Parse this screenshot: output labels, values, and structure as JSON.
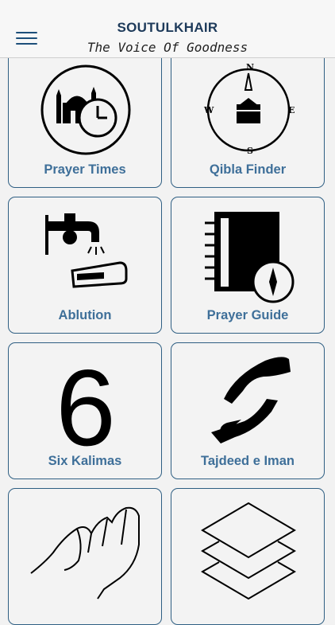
{
  "header": {
    "title": "SOUTULKHAIR",
    "subtitle": "The Voice Of Goodness",
    "menu_icon": "hamburger-menu-icon"
  },
  "tiles": [
    {
      "label": "Prayer Times",
      "icon": "mosque-clock-icon"
    },
    {
      "label": "Qibla Finder",
      "icon": "compass-kaaba-icon"
    },
    {
      "label": "Ablution",
      "icon": "faucet-hands-icon"
    },
    {
      "label": "Prayer Guide",
      "icon": "book-compass-icon"
    },
    {
      "label": "Six Kalimas",
      "icon": "number-six-icon",
      "icon_text": "6"
    },
    {
      "label": "Tajdeed e Iman",
      "icon": "hands-icon"
    },
    {
      "label": "",
      "icon": "praying-hands-icon"
    },
    {
      "label": "",
      "icon": "layers-icon"
    }
  ],
  "compass_letters": {
    "n": "N",
    "e": "E",
    "s": "S",
    "w": "W"
  },
  "colors": {
    "accent": "#1d4f7a",
    "label": "#3e6f99",
    "border": "#2f5f83"
  }
}
